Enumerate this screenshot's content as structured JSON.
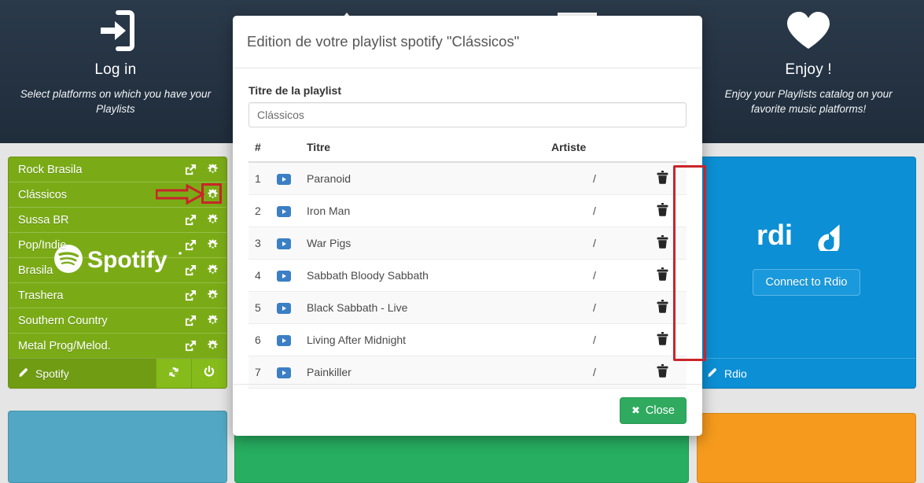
{
  "hero": {
    "columns": [
      {
        "icon": "login-icon",
        "title": "Log in",
        "subtitle": "Select platforms on which you have your Playlists"
      },
      {
        "icon": "crown-icon",
        "title": "",
        "subtitle": ""
      },
      {
        "icon": "pause-icon",
        "title": "",
        "subtitle": ""
      },
      {
        "icon": "heart-icon",
        "title": "Enjoy !",
        "subtitle": "Enjoy your Playlists catalog on your favorite music platforms!"
      }
    ]
  },
  "spotify_card": {
    "accent_color": "#7aab16",
    "footer_label": "Spotify",
    "watermark": "Spotify",
    "playlists": [
      {
        "name": "Rock Brasila",
        "share_icon": "share-icon",
        "settings_icon": "gear-icon"
      },
      {
        "name": "Clássicos",
        "share_icon": "share-icon",
        "settings_icon": "gear-icon"
      },
      {
        "name": "Sussa BR",
        "share_icon": "share-icon",
        "settings_icon": "gear-icon"
      },
      {
        "name": "Pop/Indie",
        "share_icon": "share-icon",
        "settings_icon": "gear-icon"
      },
      {
        "name": "Brasila",
        "share_icon": "share-icon",
        "settings_icon": "gear-icon"
      },
      {
        "name": "Trashera",
        "share_icon": "share-icon",
        "settings_icon": "gear-icon"
      },
      {
        "name": "Southern Country",
        "share_icon": "share-icon",
        "settings_icon": "gear-icon"
      },
      {
        "name": "Metal Prog/Melod.",
        "share_icon": "share-icon",
        "settings_icon": "gear-icon"
      }
    ],
    "footer_buttons": [
      {
        "icon": "refresh-icon"
      },
      {
        "icon": "power-icon"
      }
    ]
  },
  "rdio_card": {
    "accent_color": "#0c8fd4",
    "logo": "rdio",
    "connect_label": "Connect to Rdio",
    "footer_label": "Rdio"
  },
  "modal": {
    "title": "Edition de votre playlist spotify \"Clássicos\"",
    "field_label": "Titre de la playlist",
    "field_value": "Clássicos",
    "table": {
      "headers": [
        "#",
        "",
        "Titre",
        "Artiste",
        ""
      ],
      "rows": [
        {
          "num": "1",
          "play": "play-icon",
          "title": "Paranoid",
          "artist": "/",
          "delete": "trash-icon"
        },
        {
          "num": "2",
          "play": "play-icon",
          "title": "Iron Man",
          "artist": "/",
          "delete": "trash-icon"
        },
        {
          "num": "3",
          "play": "play-icon",
          "title": "War Pigs",
          "artist": "/",
          "delete": "trash-icon"
        },
        {
          "num": "4",
          "play": "play-icon",
          "title": "Sabbath Bloody Sabbath",
          "artist": "/",
          "delete": "trash-icon"
        },
        {
          "num": "5",
          "play": "play-icon",
          "title": "Black Sabbath - Live",
          "artist": "/",
          "delete": "trash-icon"
        },
        {
          "num": "6",
          "play": "play-icon",
          "title": "Living After Midnight",
          "artist": "/",
          "delete": "trash-icon"
        },
        {
          "num": "7",
          "play": "play-icon",
          "title": "Painkiller",
          "artist": "/",
          "delete": "trash-icon"
        }
      ]
    },
    "close_label": "Close",
    "close_icon": "x-icon"
  },
  "annotations": {
    "arrow_color": "#c9252b",
    "box_color": "#c9252b",
    "arrow_target": "gear-icon of Clássicos playlist",
    "delete_column_highlight_color": "#c9252b"
  },
  "bottom_cards": [
    {
      "name": "blue-card",
      "color": "#52a8c4"
    },
    {
      "name": "green-card",
      "color": "#27ae60"
    },
    {
      "name": "orange-card",
      "color": "#f59a1d"
    }
  ]
}
